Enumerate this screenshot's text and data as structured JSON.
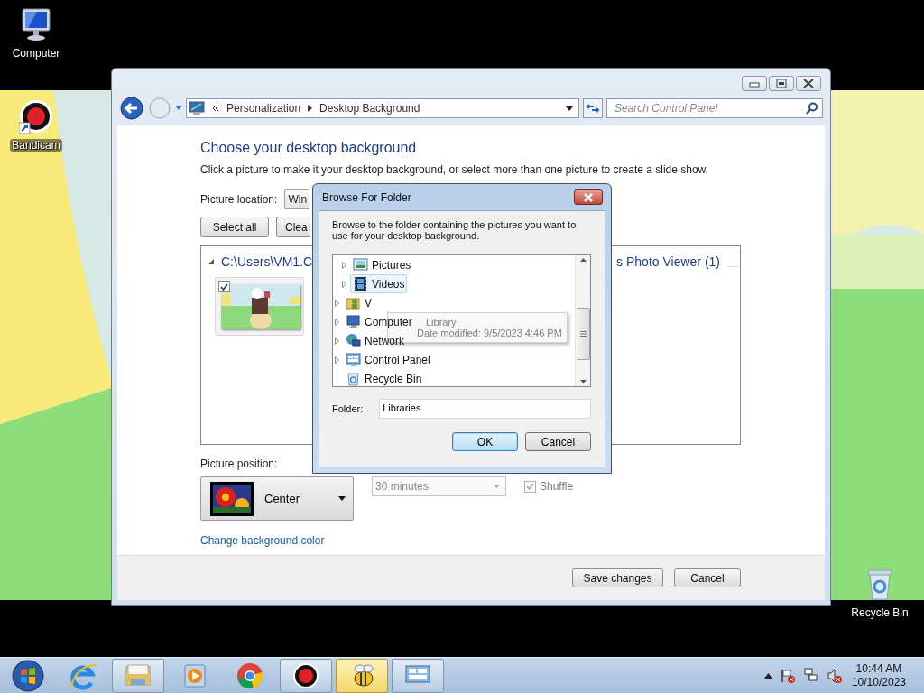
{
  "desktop": {
    "icons": [
      {
        "kind": "computer",
        "label": "Computer"
      },
      {
        "kind": "bandicam",
        "label": "Bandicam"
      },
      {
        "kind": "recycle",
        "label": "Recycle Bin"
      }
    ]
  },
  "window": {
    "breadcrumb": [
      "Personalization",
      "Desktop Background"
    ],
    "search": {
      "placeholder": "Search Control Panel"
    },
    "heading": "Choose your desktop background",
    "description": "Click a picture to make it your desktop background, or select more than one picture to create a slide show.",
    "picture_location": {
      "label": "Picture location:",
      "value": "Win"
    },
    "buttons": [
      "Select all",
      "Clea"
    ],
    "groups": [
      {
        "title": "C:\\Users\\VM1.C"
      },
      {
        "title": "s Photo Viewer (1)"
      }
    ],
    "thumbnails": [
      {
        "kind": "picture",
        "checked": true
      }
    ],
    "picture_position": {
      "label": "Picture position:",
      "value": "Center"
    },
    "interval": {
      "value": "30 minutes",
      "disabled": true
    },
    "shuffle": {
      "label": "Shuffle",
      "checked": true,
      "disabled": true
    },
    "link": "Change background color",
    "footer_buttons": [
      "Save changes",
      "Cancel"
    ]
  },
  "dialog": {
    "title": "Browse For Folder",
    "instruction": "Browse to the folder containing the pictures you want to use for your desktop background.",
    "tree": [
      {
        "children": [
          {
            "kind": "pictures",
            "label": "Pictures",
            "expandable": true,
            "hovered": false
          },
          {
            "kind": "videos",
            "label": "Videos",
            "expandable": true,
            "hovered": true
          }
        ]
      },
      {
        "kind": "user",
        "label": "V",
        "expandable": true,
        "hovered": false
      },
      {
        "kind": "computer",
        "label": "Computer",
        "expandable": true,
        "hovered": false
      },
      {
        "kind": "network",
        "label": "Network",
        "expandable": true,
        "hovered": false
      },
      {
        "kind": "control-panel",
        "label": "Control Panel",
        "expandable": true,
        "hovered": false
      },
      {
        "kind": "recycle",
        "label": "Recycle Bin",
        "expandable": false,
        "hovered": false
      }
    ],
    "tooltip": [
      "Library",
      "Date modified: 9/5/2023 4:46 PM"
    ],
    "folder": {
      "label": "Folder:",
      "value": "Libraries"
    },
    "buttons": [
      {
        "label": "OK",
        "default": true
      },
      {
        "label": "Cancel",
        "default": false
      }
    ]
  },
  "taskbar": {
    "apps": [
      {
        "kind": "ie",
        "boxed": false,
        "active": false
      },
      {
        "kind": "explorer",
        "boxed": true,
        "active": false
      },
      {
        "kind": "media",
        "boxed": false,
        "active": false
      },
      {
        "kind": "chrome",
        "boxed": false,
        "active": false
      },
      {
        "kind": "bandicam",
        "boxed": true,
        "active": false
      },
      {
        "kind": "bee",
        "boxed": true,
        "active": true
      },
      {
        "kind": "control-panel",
        "boxed": true,
        "active": false
      }
    ],
    "time": "10:44 AM",
    "date": "10/10/2023"
  }
}
